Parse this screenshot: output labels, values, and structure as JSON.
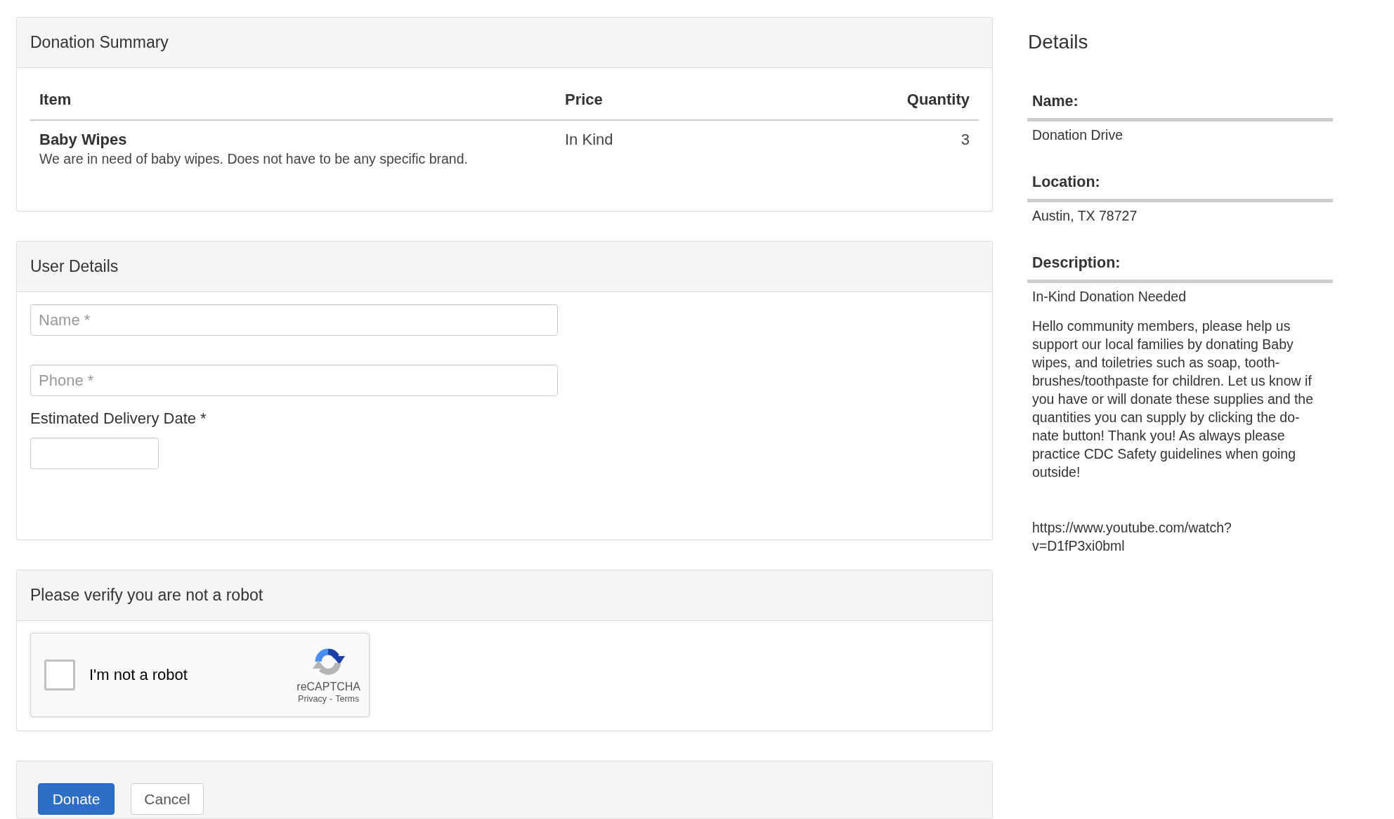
{
  "donation_summary": {
    "title": "Donation Summary",
    "columns": [
      "Item",
      "Price",
      "Quantity"
    ],
    "rows": [
      {
        "item": "Baby Wipes",
        "description": "We are in need of baby wipes. Does not have to be any specific brand.",
        "price": "In Kind",
        "quantity": "3"
      }
    ]
  },
  "user_details": {
    "title": "User Details",
    "fields": [
      {
        "kind": "text",
        "placeholder": "Name *"
      },
      {
        "kind": "text",
        "placeholder": "Phone *"
      },
      {
        "kind": "date",
        "label": "Estimated Delivery Date *"
      }
    ]
  },
  "verification": {
    "title": "Please verify you are not a robot",
    "captcha": {
      "label": "I'm not a robot",
      "checked": false,
      "brand": "reCAPTCHA",
      "links": [
        "Privacy",
        "Terms"
      ],
      "separator": "-"
    }
  },
  "actions": [
    {
      "kind": "primary",
      "label": "Donate"
    },
    {
      "kind": "secondary",
      "label": "Cancel"
    }
  ],
  "details": {
    "title": "Details",
    "fields": [
      {
        "label": "Name:",
        "value": "Donation Drive"
      },
      {
        "label": "Location:",
        "value": "Austin, TX 78727"
      },
      {
        "label": "Description:",
        "value": "In-Kind Donation Needed",
        "body": "Hello community members, please help us\nsupport our local families by donating Baby\nwipes, and toiletries such as soap, tooth-\nbrushes/toothpaste for children. Let us know if\nyou have or will donate these supplies and the\nquantities you can supply by clicking the do-\nnate button! Thank you! As always please\npractice CDC Safety guidelines when going\noutside!",
        "url": "https://www.youtube.com/watch?\nv=D1fP3xi0bml"
      }
    ]
  }
}
